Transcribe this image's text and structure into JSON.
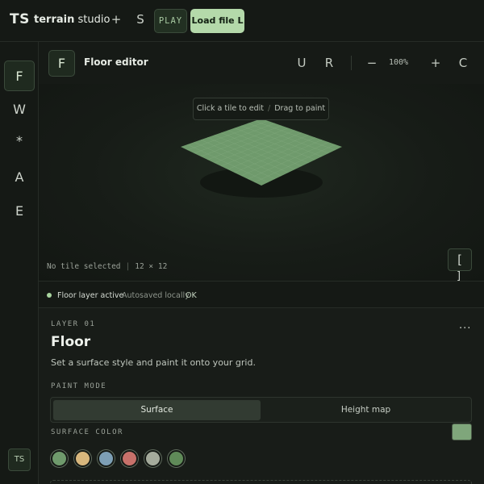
{
  "app": {
    "logo_mark": "TS",
    "name_bold": "terrain",
    "name_rest": " studio",
    "add_icon": "+",
    "s_icon": "S",
    "play_label": "PLAY",
    "load_label": "Load file L"
  },
  "rail": {
    "items": [
      {
        "label": "F",
        "active": true
      },
      {
        "label": "W",
        "active": false
      },
      {
        "label": "*",
        "active": false
      },
      {
        "label": "A",
        "active": false
      },
      {
        "label": "E",
        "active": false
      }
    ],
    "avatar": "TS"
  },
  "editor": {
    "badge": "F",
    "title": "Floor editor",
    "undo": "U",
    "redo": "R",
    "zoom_out": "−",
    "zoom_level": "100%",
    "zoom_in": "+",
    "center": "C"
  },
  "canvas": {
    "hint_left": "Click a tile to edit",
    "hint_sep": "/",
    "hint_right": "Drag to paint",
    "selection_status": "No tile selected",
    "status_sep": "|",
    "grid_size": "12 × 12",
    "grid_rows": 12,
    "grid_cols": 12,
    "corner_top": "[",
    "corner_bottom": "]",
    "tile_color": "#6f9a6c",
    "grid_line_color": "#86ad82"
  },
  "status": {
    "active": "Floor layer active",
    "saved": "Autosaved locally",
    "ok": "OK"
  },
  "panel": {
    "layer_tag": "LAYER 01",
    "more": "...",
    "title": "Floor",
    "description": "Set a surface style and paint it onto your grid.",
    "paint_mode_label": "PAINT MODE",
    "paint_modes": [
      {
        "label": "Surface",
        "active": true
      },
      {
        "label": "Height map",
        "active": false
      }
    ],
    "surface_color_label": "SURFACE COLOR",
    "selected_color": "#7fa67b",
    "swatches": [
      "#6f9a6c",
      "#d8b77d",
      "#7d9fb5",
      "#c7716a",
      "#a5ab9c",
      "#5f8a58"
    ]
  }
}
